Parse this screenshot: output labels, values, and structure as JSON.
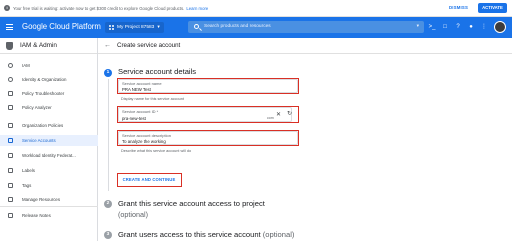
{
  "banner": {
    "text": "Your free trial is waiting: activate now to get $300 credit to explore Google Cloud products.",
    "link": "Learn more",
    "dismiss": "DISMISS",
    "activate": "ACTIVATE"
  },
  "topbar": {
    "brand": "Google Cloud Platform",
    "project": "My Project 87583",
    "project_caret": "▾",
    "search_placeholder": "Search products and resources",
    "search_caret": "▾"
  },
  "sidebar": {
    "title": "IAM & Admin",
    "items": [
      {
        "label": "IAM",
        "icon": "person-add-icon"
      },
      {
        "label": "Identity & Organization",
        "icon": "person-circle-icon"
      },
      {
        "label": "Policy Troubleshooter",
        "icon": "wrench-icon"
      },
      {
        "label": "Policy Analyzer",
        "icon": "document-search-icon"
      },
      {
        "label": "Organization Policies",
        "icon": "list-icon"
      },
      {
        "label": "Service Accounts",
        "icon": "service-account-icon",
        "active": true
      },
      {
        "label": "Workload Identity Federat...",
        "icon": "id-card-icon"
      },
      {
        "label": "Labels",
        "icon": "label-icon"
      },
      {
        "label": "Tags",
        "icon": "tag-icon"
      },
      {
        "label": "Manage Resources",
        "icon": "folder-icon"
      },
      {
        "label": "Release Notes",
        "icon": "notes-icon"
      }
    ]
  },
  "main": {
    "title": "Create service account",
    "steps": [
      {
        "num": "1",
        "title": "Service account details"
      },
      {
        "num": "2",
        "title": "Grant this service account access to project",
        "subtitle": "(optional)"
      },
      {
        "num": "3",
        "title": "Grant users access to this service account",
        "subtitle": "(optional)"
      }
    ],
    "fields": {
      "name": {
        "label": "Service account name",
        "value": "PRA NEW Test",
        "hint": "Display name for this service account"
      },
      "id": {
        "label": "Service account ID *",
        "value": "pra-new-test",
        "suffix": "com"
      },
      "desc": {
        "label": "Service account description",
        "value": "To analyze the working",
        "hint": "Describe what this service account will do"
      }
    },
    "create_button": "CREATE AND CONTINUE"
  },
  "colors": {
    "accent": "#1a73e8",
    "highlight": "#d93025",
    "active_bg": "#e8f0fe"
  }
}
